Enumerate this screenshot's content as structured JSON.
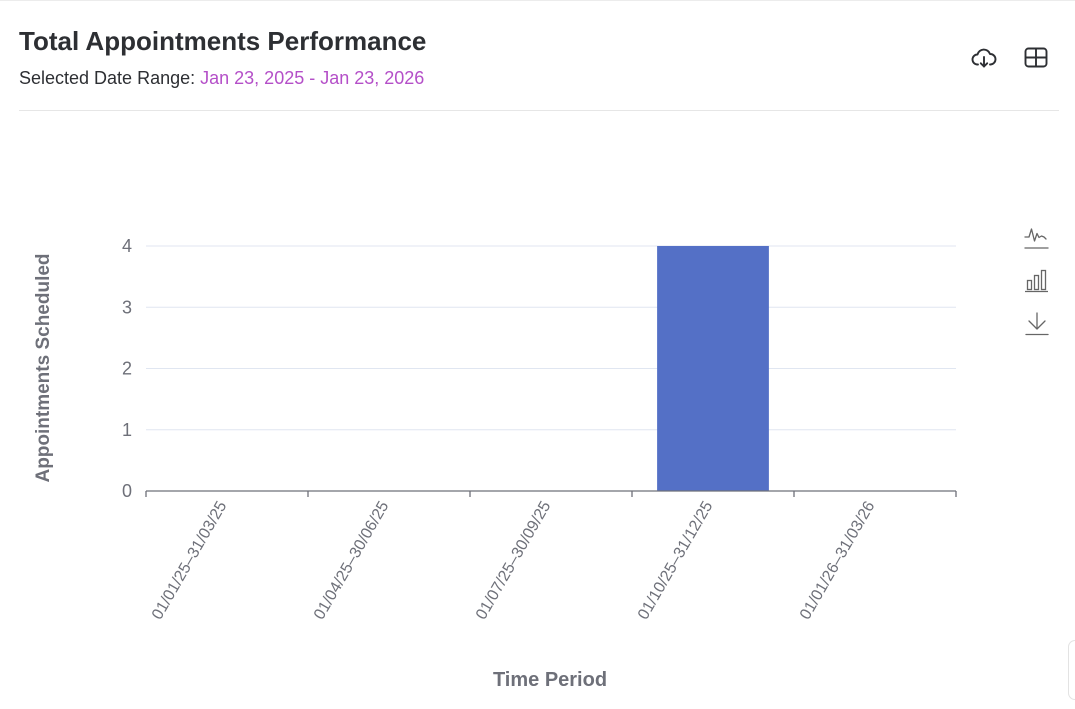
{
  "header": {
    "title": "Total Appointments Performance",
    "range_label": "Selected Date Range:",
    "range_value": "Jan 23, 2025 - Jan 23, 2026",
    "range_color": "#b44fc8"
  },
  "icons": {
    "download": "cloud-download-icon",
    "table": "table-grid-icon",
    "line": "line-chart-icon",
    "bar": "bar-chart-icon",
    "save": "save-image-icon"
  },
  "chart_data": {
    "type": "bar",
    "categories": [
      "01/01/25–31/03/25",
      "01/04/25–30/06/25",
      "01/07/25–30/09/25",
      "01/10/25–31/12/25",
      "01/01/26–31/03/26"
    ],
    "values": [
      0,
      0,
      0,
      4,
      0
    ],
    "xlabel": "Time Period",
    "ylabel": "Appointments Scheduled",
    "ylim": [
      0,
      4
    ],
    "yticks": [
      0,
      1,
      2,
      3,
      4
    ],
    "bar_color": "#5470c6",
    "grid": true,
    "legend": "none"
  }
}
